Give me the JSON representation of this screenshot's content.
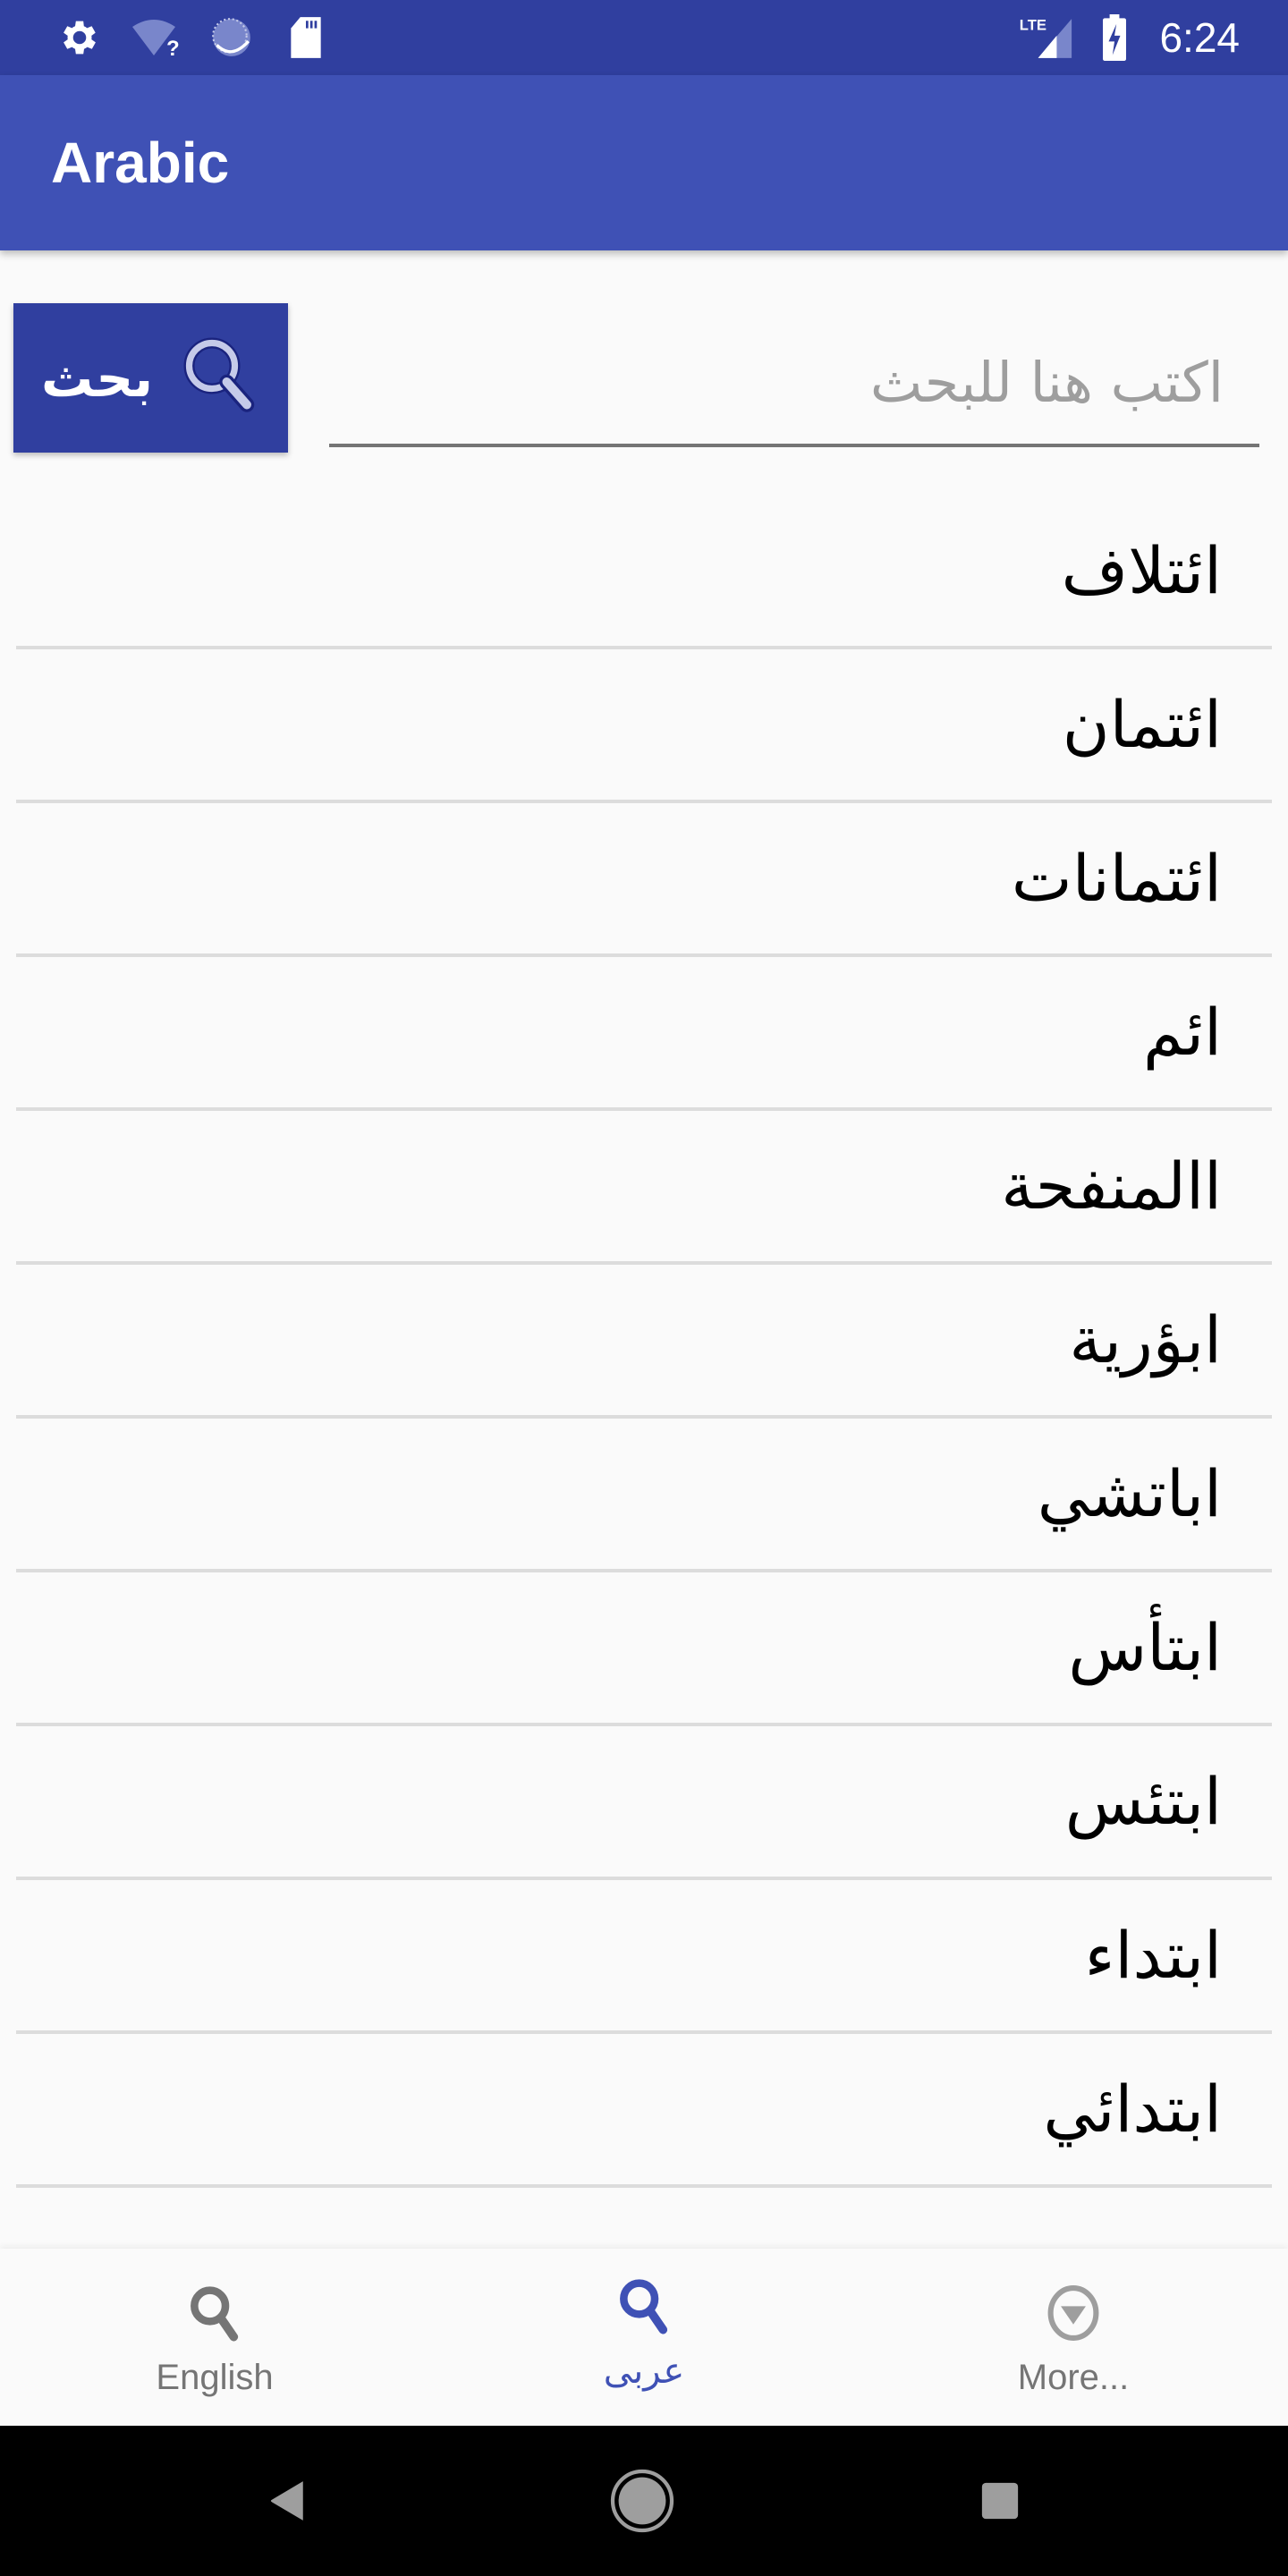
{
  "status_bar": {
    "time": "6:24",
    "network_label": "LTE",
    "left_icons": [
      "gear-icon",
      "wifi-unknown-icon",
      "sync-icon",
      "sd-card-icon"
    ],
    "right_icons": [
      "lte-signal-icon",
      "battery-charging-icon"
    ]
  },
  "app_bar": {
    "title": "Arabic"
  },
  "search": {
    "button_label": "بحث",
    "button_icon": "magnifier-icon",
    "placeholder": "اكتب هنا للبحث",
    "value": ""
  },
  "word_list": {
    "items": [
      "ائتلاف",
      "ائتمان",
      "ائتمانات",
      "ائم",
      "االمنفحة",
      "ابؤرية",
      "اباتشي",
      "ابتأس",
      "ابتئس",
      "ابتداء",
      "ابتدائي"
    ]
  },
  "bottom_nav": {
    "tabs": [
      {
        "label": "English",
        "icon": "search-icon",
        "active": false
      },
      {
        "label": "عربى",
        "icon": "search-icon",
        "active": true
      },
      {
        "label": "More...",
        "icon": "dropdown-circle-icon",
        "active": false
      }
    ]
  },
  "colors": {
    "status_bar": "#303f9f",
    "app_bar": "#3f51b5",
    "search_button": "#303f9f",
    "active_tab": "#3f51b5",
    "inactive_tab": "#757575",
    "background": "#fafafa",
    "divider": "#dcdcdc"
  },
  "system_nav": {
    "buttons": [
      "back-icon",
      "home-icon",
      "recents-icon"
    ]
  }
}
